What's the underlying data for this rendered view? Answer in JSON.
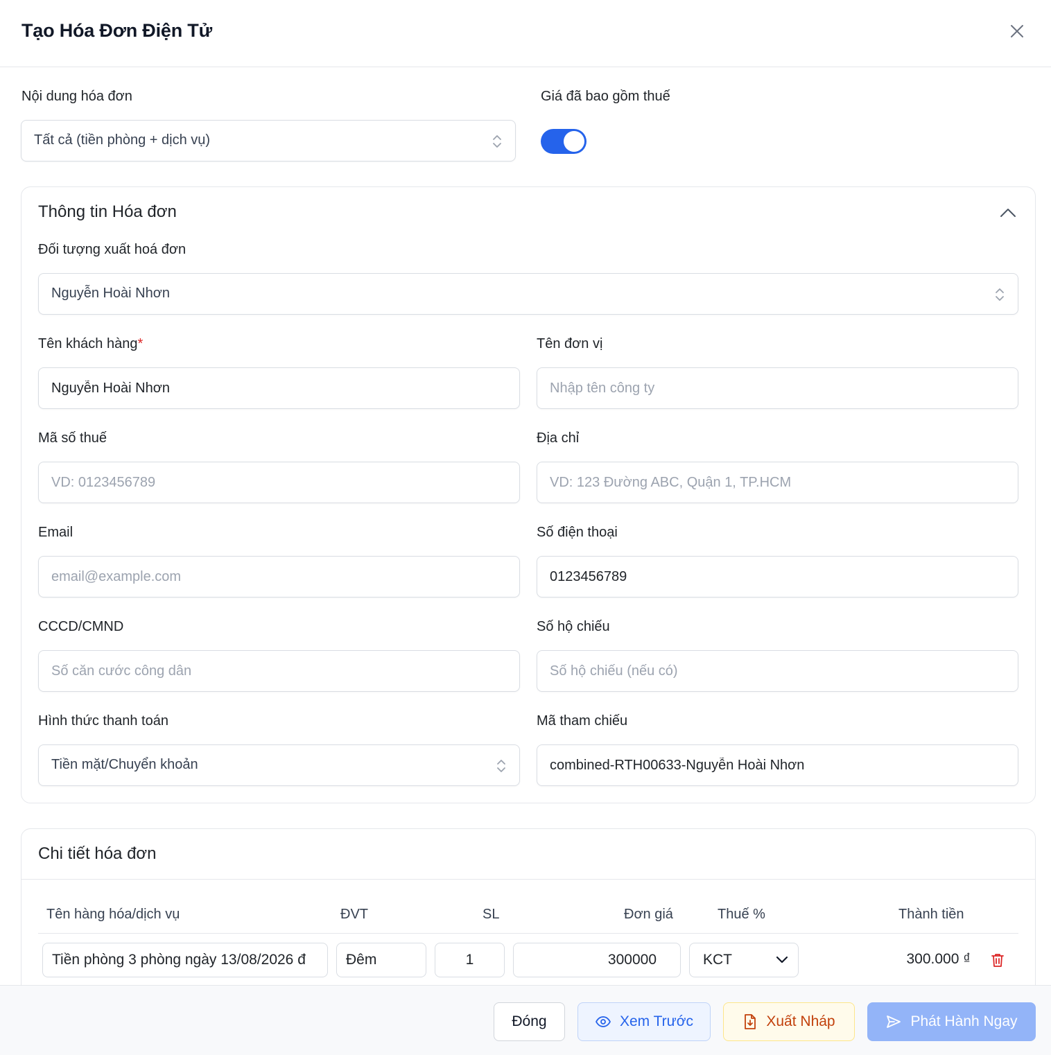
{
  "dialog": {
    "title": "Tạo Hóa Đơn Điện Tử"
  },
  "top": {
    "content_label": "Nội dung hóa đơn",
    "content_value": "Tất cả (tiền phòng + dịch vụ)",
    "tax_included_label": "Giá đã bao gồm thuế",
    "tax_included_on": true
  },
  "info": {
    "section_title": "Thông tin Hóa đơn",
    "recipient_label": "Đối tượng xuất hoá đơn",
    "recipient_value": "Nguyễn Hoài Nhơn",
    "customer_name_label": "Tên khách hàng",
    "required_mark": "*",
    "customer_name_value": "Nguyễn Hoài Nhơn",
    "company_label": "Tên đơn vị",
    "company_placeholder": "Nhập tên công ty",
    "tax_code_label": "Mã số thuế",
    "tax_code_placeholder": "VD: 0123456789",
    "address_label": "Địa chỉ",
    "address_placeholder": "VD: 123 Đường ABC, Quận 1, TP.HCM",
    "email_label": "Email",
    "email_placeholder": "email@example.com",
    "phone_label": "Số điện thoại",
    "phone_value": "0123456789",
    "id_label": "CCCD/CMND",
    "id_placeholder": "Số căn cước công dân",
    "passport_label": "Số hộ chiếu",
    "passport_placeholder": "Số hộ chiếu (nếu có)",
    "payment_label": "Hình thức thanh toán",
    "payment_value": "Tiền mặt/Chuyển khoản",
    "reference_label": "Mã tham chiếu",
    "reference_value": "combined-RTH00633-Nguyễn Hoài Nhơn"
  },
  "details": {
    "section_title": "Chi tiết hóa đơn",
    "columns": {
      "name": "Tên hàng hóa/dịch vụ",
      "unit": "ĐVT",
      "qty": "SL",
      "price": "Đơn giá",
      "tax": "Thuế %",
      "total": "Thành tiền"
    },
    "rows": [
      {
        "name": "Tiền phòng 3 phòng ngày 13/08/2026 đ",
        "unit": "Đêm",
        "qty": "1",
        "price": "300000",
        "tax": "KCT",
        "total": "300.000 ₫"
      }
    ]
  },
  "footer": {
    "close_label": "Đóng",
    "preview_label": "Xem Trước",
    "draft_label": "Xuất Nháp",
    "issue_label": "Phát Hành Ngay"
  },
  "colors": {
    "accent": "#2563eb",
    "danger": "#dc2626",
    "preview_bg": "#eef4ff",
    "draft_bg": "#fffbeb",
    "draft_text": "#c2410c",
    "issue_bg": "#93b4f8"
  },
  "icons": [
    "close-icon",
    "chevron-updown-icon",
    "chevron-up-icon",
    "chevron-down-icon",
    "trash-icon",
    "eye-icon",
    "file-download-icon",
    "send-icon"
  ]
}
